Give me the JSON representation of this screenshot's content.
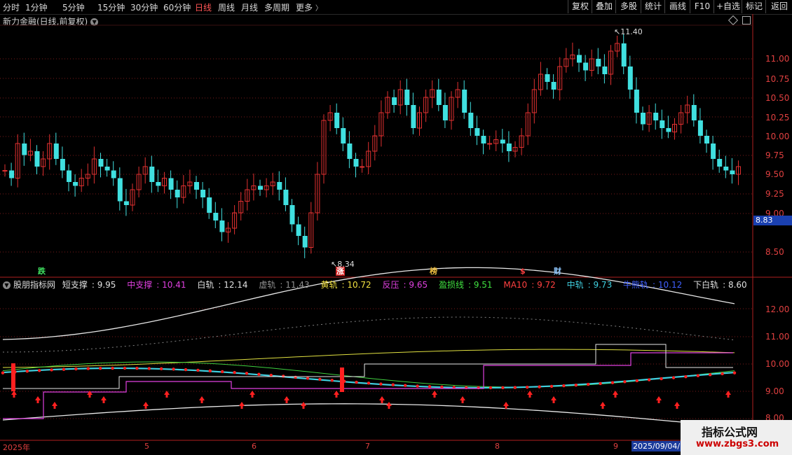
{
  "toolbar": {
    "periods": [
      "分时",
      "1分钟",
      "5分钟",
      "15分钟",
      "30分钟",
      "60分钟",
      "日线",
      "周线",
      "月线",
      "多周期",
      "更多"
    ],
    "active_period": "日线",
    "actions": [
      "复权",
      "叠加",
      "多股",
      "统计",
      "画线",
      "F10",
      "+自选",
      "标记",
      "返回"
    ]
  },
  "chart_title": {
    "name": "新力金融(日线,前复权)"
  },
  "main_chart": {
    "price_ticks": [
      "11.00",
      "10.75",
      "10.50",
      "10.25",
      "10.00",
      "9.75",
      "9.50",
      "9.25",
      "9.00",
      "8.50"
    ],
    "high_label": "11.40",
    "low_label": "8.34",
    "current_price": "8.83",
    "markers": [
      {
        "text": "跌",
        "color": "#40e060",
        "bg": "#000"
      },
      {
        "text": "涨",
        "color": "#ffffff",
        "bg": "#d02020"
      },
      {
        "text": "榜",
        "color": "#f0c040",
        "bg": "#000"
      },
      {
        "text": "$",
        "color": "#ff4040",
        "bg": "#000"
      },
      {
        "text": "财",
        "color": "#8fc8ff",
        "bg": "#000"
      }
    ]
  },
  "indicator": {
    "name": "股朋指标网",
    "values": [
      {
        "label": "短支撑",
        "value": "9.95",
        "color": "#e0e0e0"
      },
      {
        "label": "中支撑",
        "value": "10.41",
        "color": "#e040e0"
      },
      {
        "label": "白轨",
        "value": "12.14",
        "color": "#e0e0e0"
      },
      {
        "label": "虚轨",
        "value": "11.43",
        "color": "#909090"
      },
      {
        "label": "黄轨",
        "value": "10.72",
        "color": "#f0e040"
      },
      {
        "label": "反压",
        "value": "9.65",
        "color": "#e040e0"
      },
      {
        "label": "盈损线",
        "value": "9.51",
        "color": "#40e040"
      },
      {
        "label": "MA10",
        "value": "9.72",
        "color": "#ff4040"
      },
      {
        "label": "中轨",
        "value": "9.73",
        "color": "#40d0e0"
      },
      {
        "label": "牛熊轨",
        "value": "10.12",
        "color": "#4060ff"
      },
      {
        "label": "下白轨",
        "value": "8.60",
        "color": "#e0e0e0"
      }
    ],
    "ticks": [
      "12.00",
      "11.00",
      "10.00",
      "9.00",
      "8.00"
    ]
  },
  "date_axis": {
    "labels": [
      "2025年",
      "5",
      "6",
      "7",
      "8",
      "9"
    ],
    "cursor_date": "2025/09/04/四"
  },
  "watermark": {
    "title": "指标公式网",
    "url": "www.zbgs3.com"
  }
}
